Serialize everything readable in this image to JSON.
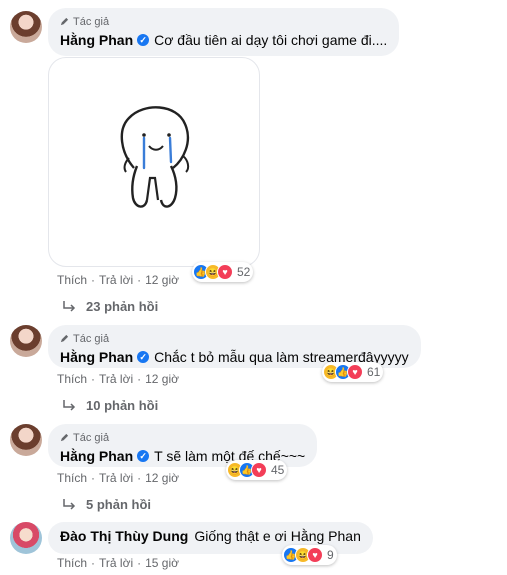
{
  "comments": [
    {
      "badge": "Tác giả",
      "name": "Hằng Phan",
      "text": "Cơ đầu tiên ai dạy tôi chơi game đi....",
      "like": "Thích",
      "reply": "Trả lời",
      "time": "12 giờ",
      "reaction_count": "52",
      "replies_label": "23 phản hồi"
    },
    {
      "badge": "Tác giả",
      "name": "Hằng Phan",
      "text": "Chắc t bỏ mẫu qua làm streamerđâyyyyy",
      "like": "Thích",
      "reply": "Trả lời",
      "time": "12 giờ",
      "reaction_count": "61",
      "replies_label": "10 phản hồi"
    },
    {
      "badge": "Tác giả",
      "name": "Hằng Phan",
      "text": "T sẽ làm một đế chế~~~",
      "like": "Thích",
      "reply": "Trả lời",
      "time": "12 giờ",
      "reaction_count": "45",
      "replies_label": "5 phản hồi"
    },
    {
      "name": "Đào Thị Thùy Dung",
      "text": "Giống thật e ơi",
      "mention": "Hằng Phan",
      "like": "Thích",
      "reply": "Trả lời",
      "time": "15 giờ",
      "reaction_count": "9"
    }
  ],
  "colors": {
    "bubble": "#f0f2f5",
    "meta_text": "#65676b",
    "like_blue": "#1877f2",
    "haha_yellow": "#f7b928",
    "love_red": "#f33e58"
  }
}
